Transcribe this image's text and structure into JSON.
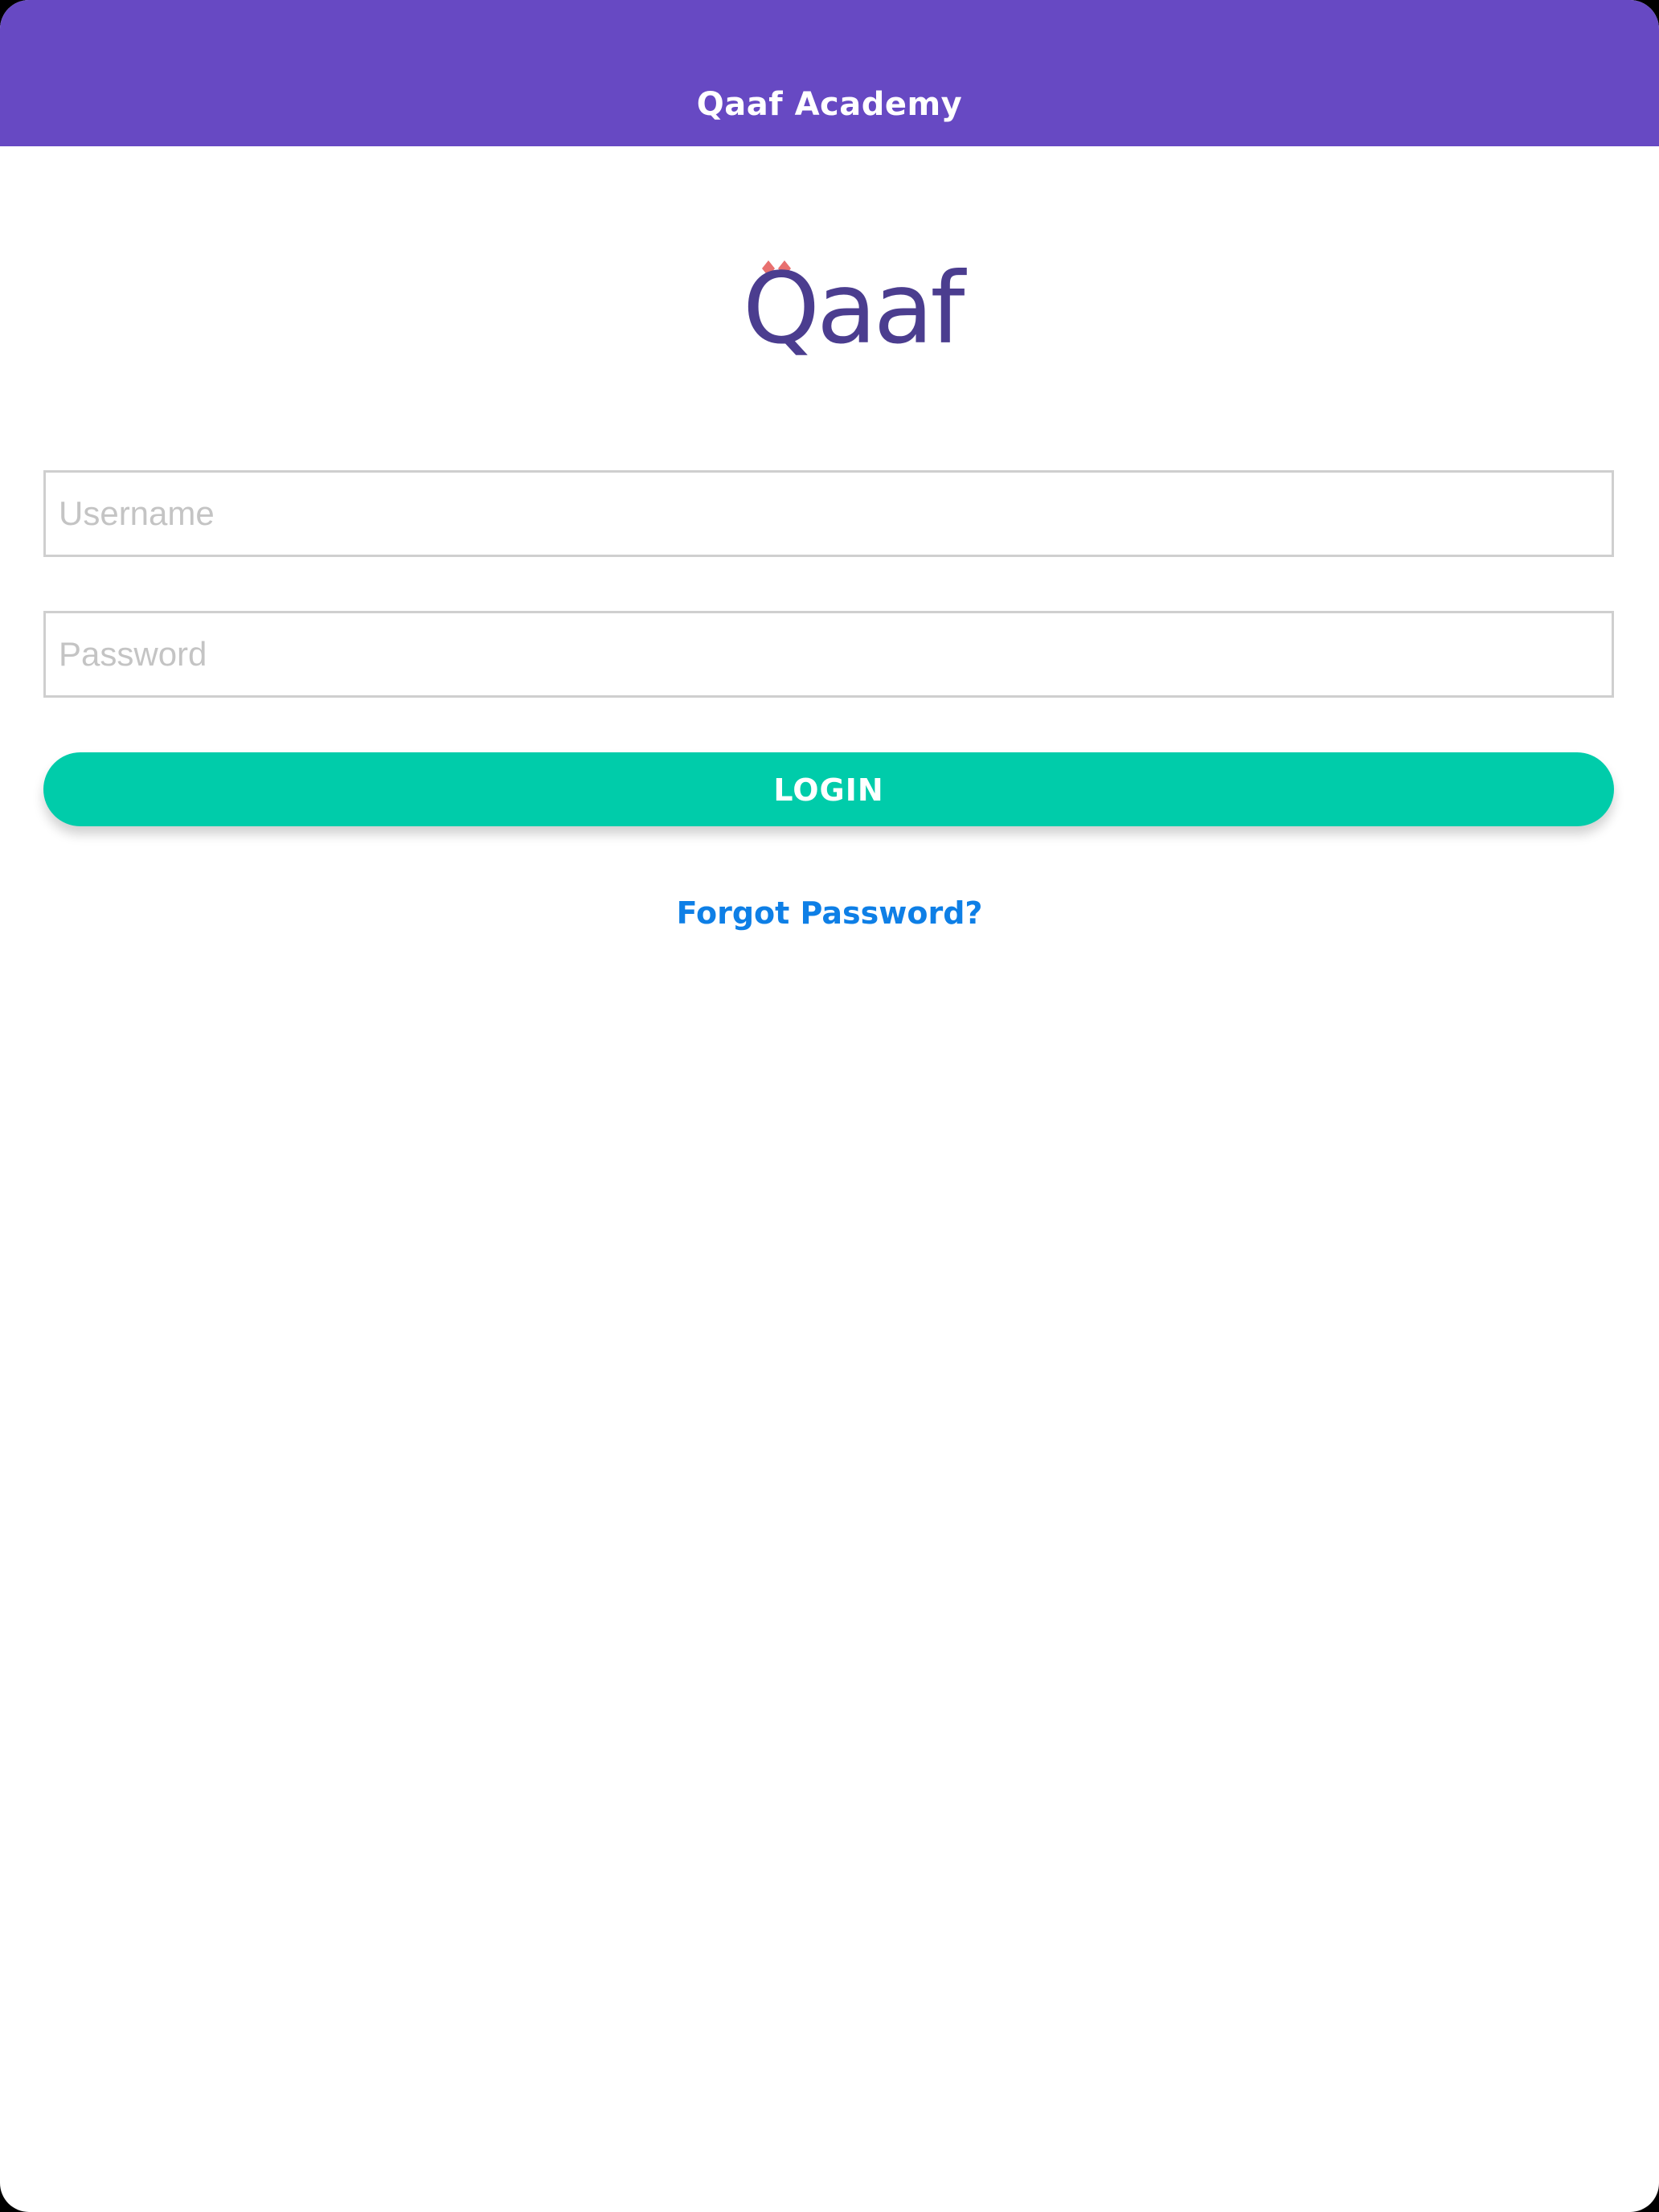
{
  "app": {
    "title": "Qaaf Academy"
  },
  "logo": {
    "text": "Qaaf",
    "icon": "qaaf-logo",
    "text_color": "#4B3D8F",
    "dot_color": "#E8706F"
  },
  "form": {
    "username_placeholder": "Username",
    "username_value": "",
    "password_placeholder": "Password",
    "password_value": "",
    "login_label": "LOGIN",
    "forgot_label": "Forgot Password?"
  },
  "colors": {
    "header": "#6749C3",
    "login_button": "#00CCAA",
    "link": "#0E7FE6"
  }
}
